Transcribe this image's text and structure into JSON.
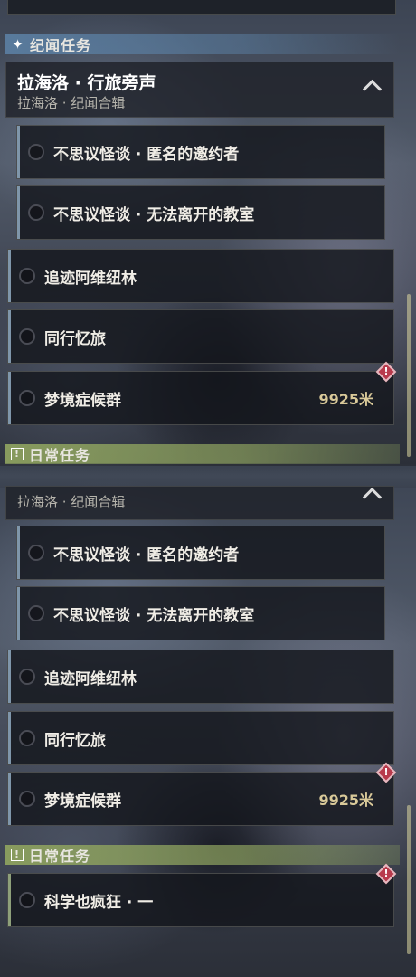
{
  "top": {
    "category_journey": {
      "label": "纪闻任务",
      "icon": "sparkle-icon"
    },
    "group": {
      "title": "拉海洛 · 行旅旁声",
      "subtitle": "拉海洛 · 纪闻合辑",
      "icon": "chevron-up-icon"
    },
    "quests": [
      {
        "name": "不思议怪谈 · 匿名的邀约者"
      },
      {
        "name": "不思议怪谈 · 无法离开的教室"
      },
      {
        "name": "追迹阿维纽林"
      },
      {
        "name": "同行忆旅"
      },
      {
        "name": "梦境症候群",
        "distance": "9925米",
        "alert": "!"
      }
    ],
    "category_daily": {
      "label": "日常任务",
      "icon": "!"
    }
  },
  "bottom": {
    "group": {
      "subtitle": "拉海洛 · 纪闻合辑",
      "icon": "chevron-up-icon"
    },
    "quests": [
      {
        "name": "不思议怪谈 · 匿名的邀约者"
      },
      {
        "name": "不思议怪谈 · 无法离开的教室"
      },
      {
        "name": "追迹阿维纽林"
      },
      {
        "name": "同行忆旅"
      },
      {
        "name": "梦境症候群",
        "distance": "9925米",
        "alert": "!"
      }
    ],
    "category_daily": {
      "label": "日常任务",
      "icon": "!"
    },
    "daily_quest": {
      "name": "科学也疯狂 · 一",
      "alert": "!"
    }
  }
}
